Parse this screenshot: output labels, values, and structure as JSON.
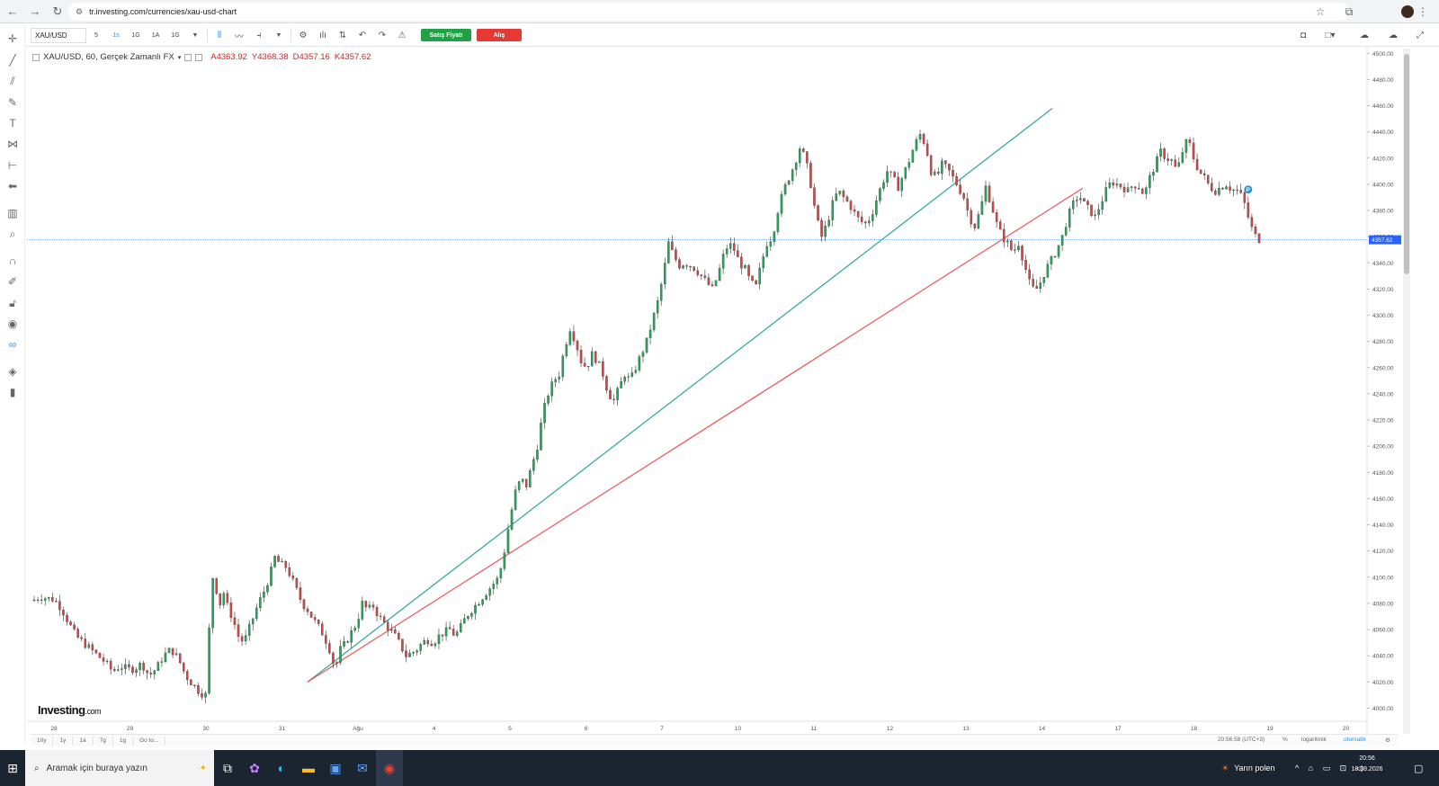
{
  "browser": {
    "url": "tr.investing.com/currencies/xau-usd-chart"
  },
  "toolbar": {
    "symbol": "XAU/USD",
    "timeframes": [
      "5",
      "1s",
      "1G",
      "1A",
      "1G"
    ],
    "active_timeframe_index": 1,
    "sell_label": "Satış Fiyatı",
    "buy_label": "Alış"
  },
  "legend": {
    "title": "XAU/USD, 60, Gerçek Zamanlı FX",
    "open": "A4363.92",
    "high": "Y4368.38",
    "low": "D4357.16",
    "close": "K4357.62"
  },
  "chart_data": {
    "type": "candlestick",
    "title": "XAU/USD, 60, Gerçek Zamanlı FX",
    "ylim": [
      3990,
      4505
    ],
    "y_ticks": [
      "4500.00",
      "4480.00",
      "4460.00",
      "4440.00",
      "4420.00",
      "4400.00",
      "4380.00",
      "4360.00",
      "4340.00",
      "4320.00",
      "4300.00",
      "4280.00",
      "4260.00",
      "4240.00",
      "4220.00",
      "4200.00",
      "4180.00",
      "4160.00",
      "4140.00",
      "4120.00",
      "4100.00",
      "4080.00",
      "4060.00",
      "4040.00",
      "4020.00",
      "4000.00",
      "3980.00"
    ],
    "x_ticks": [
      "28",
      "29",
      "30",
      "31",
      "Ağu",
      "4",
      "5",
      "6",
      "7",
      "10",
      "11",
      "12",
      "13",
      "14",
      "17",
      "18",
      "19",
      "20"
    ],
    "current_price": "4357.62",
    "price_path": [
      [
        0,
        4082
      ],
      [
        4,
        4085
      ],
      [
        8,
        4084
      ],
      [
        12,
        4083
      ],
      [
        16,
        4076
      ],
      [
        20,
        4065
      ],
      [
        24,
        4055
      ],
      [
        28,
        4050
      ],
      [
        32,
        4045
      ],
      [
        36,
        4040
      ],
      [
        40,
        4035
      ],
      [
        44,
        4028
      ],
      [
        48,
        4032
      ],
      [
        52,
        4030
      ],
      [
        56,
        4030
      ],
      [
        60,
        4034
      ],
      [
        64,
        4025
      ],
      [
        68,
        4030
      ],
      [
        72,
        4040
      ],
      [
        76,
        4045
      ],
      [
        80,
        4038
      ],
      [
        84,
        4025
      ],
      [
        88,
        4018
      ],
      [
        92,
        4012
      ],
      [
        95,
        4010
      ],
      [
        97,
        4060
      ],
      [
        99,
        4100
      ],
      [
        101,
        4090
      ],
      [
        103,
        4080
      ],
      [
        105,
        4088
      ],
      [
        107,
        4078
      ],
      [
        110,
        4068
      ],
      [
        113,
        4055
      ],
      [
        116,
        4050
      ],
      [
        120,
        4065
      ],
      [
        124,
        4080
      ],
      [
        128,
        4092
      ],
      [
        131,
        4105
      ],
      [
        133,
        4115
      ],
      [
        136,
        4110
      ],
      [
        139,
        4108
      ],
      [
        142,
        4100
      ],
      [
        145,
        4090
      ],
      [
        148,
        4080
      ],
      [
        151,
        4075
      ],
      [
        154,
        4068
      ],
      [
        157,
        4062
      ],
      [
        160,
        4055
      ],
      [
        163,
        4045
      ],
      [
        166,
        4030
      ],
      [
        169,
        4045
      ],
      [
        172,
        4050
      ],
      [
        175,
        4058
      ],
      [
        178,
        4065
      ],
      [
        181,
        4080
      ],
      [
        184,
        4075
      ],
      [
        187,
        4078
      ],
      [
        190,
        4070
      ],
      [
        193,
        4065
      ],
      [
        196,
        4060
      ],
      [
        199,
        4055
      ],
      [
        202,
        4048
      ],
      [
        205,
        4040
      ],
      [
        208,
        4042
      ],
      [
        211,
        4045
      ],
      [
        214,
        4050
      ],
      [
        217,
        4052
      ],
      [
        220,
        4050
      ],
      [
        223,
        4055
      ],
      [
        226,
        4058
      ],
      [
        229,
        4060
      ],
      [
        232,
        4055
      ],
      [
        235,
        4062
      ],
      [
        238,
        4070
      ],
      [
        241,
        4075
      ],
      [
        244,
        4080
      ],
      [
        247,
        4085
      ],
      [
        250,
        4090
      ],
      [
        253,
        4095
      ],
      [
        256,
        4100
      ],
      [
        259,
        4120
      ],
      [
        262,
        4145
      ],
      [
        265,
        4165
      ],
      [
        268,
        4175
      ],
      [
        271,
        4170
      ],
      [
        274,
        4185
      ],
      [
        277,
        4200
      ],
      [
        280,
        4225
      ],
      [
        283,
        4240
      ],
      [
        286,
        4250
      ],
      [
        289,
        4255
      ],
      [
        292,
        4275
      ],
      [
        295,
        4290
      ],
      [
        298,
        4280
      ],
      [
        301,
        4265
      ],
      [
        304,
        4260
      ],
      [
        307,
        4270
      ],
      [
        310,
        4265
      ],
      [
        313,
        4255
      ],
      [
        316,
        4240
      ],
      [
        319,
        4235
      ],
      [
        322,
        4245
      ],
      [
        325,
        4255
      ],
      [
        328,
        4250
      ],
      [
        331,
        4260
      ],
      [
        334,
        4270
      ],
      [
        337,
        4280
      ],
      [
        340,
        4295
      ],
      [
        343,
        4310
      ],
      [
        346,
        4330
      ],
      [
        349,
        4355
      ],
      [
        352,
        4345
      ],
      [
        355,
        4338
      ],
      [
        358,
        4340
      ],
      [
        361,
        4338
      ],
      [
        364,
        4335
      ],
      [
        367,
        4330
      ],
      [
        370,
        4325
      ],
      [
        373,
        4320
      ],
      [
        376,
        4330
      ],
      [
        379,
        4345
      ],
      [
        382,
        4355
      ],
      [
        385,
        4350
      ],
      [
        388,
        4340
      ],
      [
        391,
        4335
      ],
      [
        394,
        4325
      ],
      [
        397,
        4322
      ],
      [
        400,
        4340
      ],
      [
        403,
        4355
      ],
      [
        406,
        4360
      ],
      [
        409,
        4380
      ],
      [
        412,
        4395
      ],
      [
        415,
        4405
      ],
      [
        418,
        4415
      ],
      [
        421,
        4428
      ],
      [
        424,
        4420
      ],
      [
        427,
        4400
      ],
      [
        430,
        4375
      ],
      [
        433,
        4360
      ],
      [
        436,
        4370
      ],
      [
        439,
        4385
      ],
      [
        442,
        4395
      ],
      [
        445,
        4390
      ],
      [
        448,
        4385
      ],
      [
        451,
        4378
      ],
      [
        454,
        4372
      ],
      [
        457,
        4370
      ],
      [
        460,
        4375
      ],
      [
        463,
        4388
      ],
      [
        466,
        4400
      ],
      [
        469,
        4410
      ],
      [
        472,
        4405
      ],
      [
        475,
        4398
      ],
      [
        478,
        4408
      ],
      [
        481,
        4418
      ],
      [
        484,
        4430
      ],
      [
        487,
        4438
      ],
      [
        490,
        4430
      ],
      [
        493,
        4410
      ],
      [
        496,
        4405
      ],
      [
        499,
        4415
      ],
      [
        502,
        4412
      ],
      [
        505,
        4405
      ],
      [
        508,
        4398
      ],
      [
        511,
        4390
      ],
      [
        514,
        4375
      ],
      [
        517,
        4368
      ],
      [
        520,
        4380
      ],
      [
        523,
        4398
      ],
      [
        526,
        4385
      ],
      [
        529,
        4370
      ],
      [
        532,
        4360
      ],
      [
        535,
        4355
      ],
      [
        538,
        4348
      ],
      [
        541,
        4355
      ],
      [
        544,
        4340
      ],
      [
        547,
        4325
      ],
      [
        550,
        4318
      ],
      [
        553,
        4325
      ],
      [
        556,
        4335
      ],
      [
        559,
        4342
      ],
      [
        562,
        4350
      ],
      [
        565,
        4360
      ],
      [
        568,
        4375
      ],
      [
        571,
        4385
      ],
      [
        574,
        4392
      ],
      [
        577,
        4385
      ],
      [
        580,
        4380
      ],
      [
        583,
        4375
      ],
      [
        586,
        4385
      ],
      [
        589,
        4395
      ],
      [
        592,
        4402
      ],
      [
        595,
        4400
      ],
      [
        598,
        4398
      ],
      [
        601,
        4395
      ],
      [
        604,
        4400
      ],
      [
        607,
        4398
      ],
      [
        610,
        4392
      ],
      [
        613,
        4405
      ],
      [
        616,
        4415
      ],
      [
        619,
        4425
      ],
      [
        622,
        4420
      ],
      [
        625,
        4418
      ],
      [
        628,
        4410
      ],
      [
        631,
        4425
      ],
      [
        634,
        4435
      ],
      [
        637,
        4420
      ],
      [
        640,
        4410
      ],
      [
        643,
        4405
      ],
      [
        646,
        4398
      ],
      [
        649,
        4395
      ],
      [
        652,
        4398
      ],
      [
        655,
        4400
      ],
      [
        658,
        4396
      ],
      [
        661,
        4395
      ],
      [
        664,
        4390
      ],
      [
        667,
        4375
      ],
      [
        670,
        4362
      ],
      [
        673,
        4358
      ]
    ],
    "trendlines": [
      {
        "name": "green-trendline",
        "color": "#26a69a",
        "from": [
          4,
          4020
        ],
        "to": [
          13.8,
          4458
        ]
      },
      {
        "name": "red-trendline",
        "color": "#ef5350",
        "from": [
          4,
          4020
        ],
        "to": [
          14.2,
          4397
        ]
      }
    ]
  },
  "bottom_bar": {
    "ranges": [
      "10y",
      "1y",
      "1a",
      "7g",
      "1g",
      "Go to..."
    ],
    "time": "20:56:58 (UTC+3)",
    "percent": "%",
    "log": "logaritmik",
    "auto": "otomatik"
  },
  "taskbar": {
    "search_placeholder": "Aramak için buraya yazın",
    "weather": "Yarın polen",
    "time": "20:56",
    "date": "18.08.2026"
  }
}
